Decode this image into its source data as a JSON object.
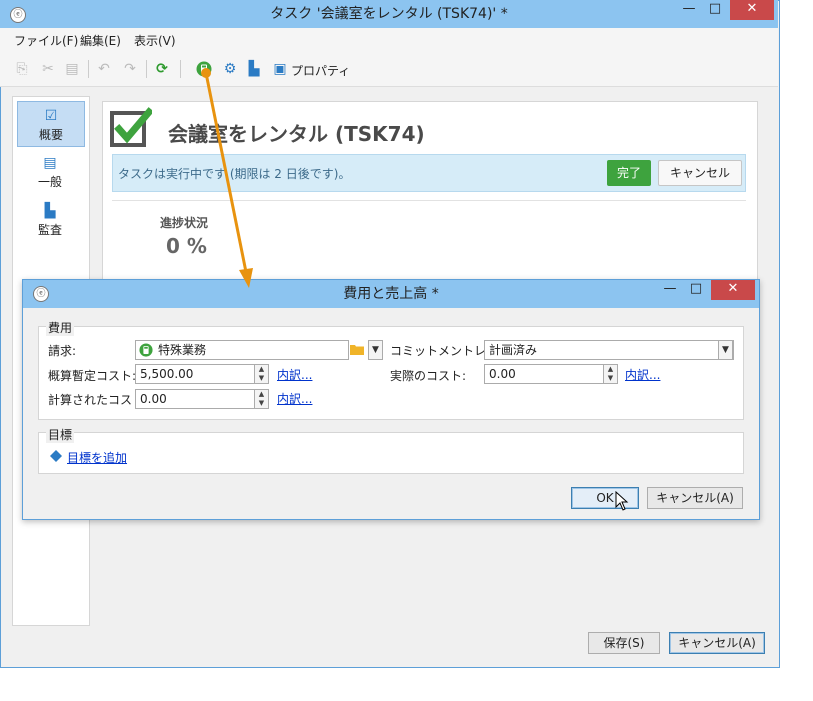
{
  "main_window": {
    "title": "タスク '会議室をレンタル (TSK74)' *",
    "app_icon": "gear-spiral-icon",
    "controls": {
      "minimize": "—",
      "maximize": "□",
      "close": "✕"
    }
  },
  "menu": [
    "ファイル(F)",
    "編集(E)",
    "表示(V)"
  ],
  "toolbar": {
    "properties_label": "プロパティ",
    "icons": [
      "copy-icon",
      "cut-icon",
      "paste-icon",
      "undo-icon",
      "redo-icon",
      "refresh-icon",
      "calculator-icon",
      "settings-icon",
      "owner-icon",
      "properties-icon"
    ]
  },
  "sidebar": [
    {
      "label": "概要",
      "icon": "checkbox-icon",
      "active": true
    },
    {
      "label": "一般",
      "icon": "clipboard-icon",
      "active": false
    },
    {
      "label": "監査",
      "icon": "audit-icon",
      "active": false
    }
  ],
  "task": {
    "title": "会議室をレンタル (TSK74)",
    "status_text": "タスクは実行中です (期限は 2 日後です)。",
    "done_label": "完了",
    "cancel_label": "キャンセル",
    "progress_label": "進捗状況",
    "progress_value": "0 %"
  },
  "footer_buttons": {
    "save": "保存(S)",
    "cancel": "キャンセル(A)"
  },
  "dialog": {
    "title": "費用と売上高 *",
    "costs_group": "費用",
    "billing_label": "請求:",
    "billing_value": "特殊業務",
    "commitment_label": "コミットメントレベル:",
    "commitment_value": "計画済み",
    "estimated_cost_label": "概算暫定コスト:",
    "estimated_cost_value": "5,500.00",
    "actual_cost_label": "実際のコスト:",
    "actual_cost_value": "0.00",
    "calculated_cost_label": "計算されたコスト:",
    "calculated_cost_value": "0.00",
    "details_link": "内訳...",
    "goals_group": "目標",
    "add_goal_link": "目標を追加",
    "ok_label": "OK",
    "cancel_label": "キャンセル(A)"
  },
  "colors": {
    "titlebar": "#8cc4f0",
    "accent": "#3ea33e",
    "close": "#c9494a",
    "arrow": "#e8930f"
  }
}
